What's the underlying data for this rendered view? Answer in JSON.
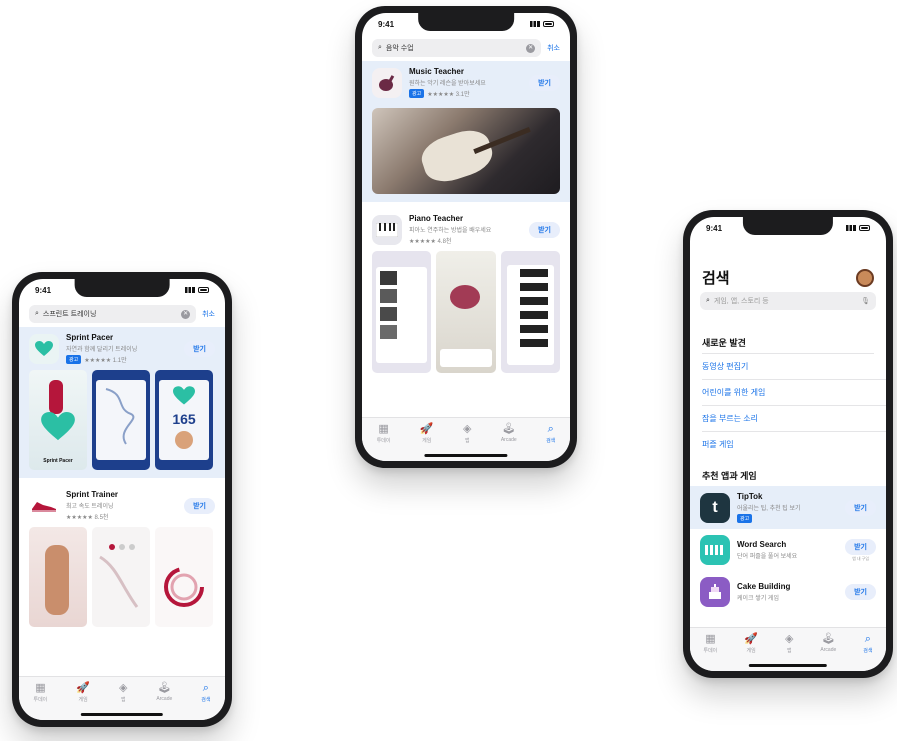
{
  "status": {
    "time": "9:41"
  },
  "tabs": [
    {
      "label": "투데이",
      "icon": "today-icon",
      "glyph": "▦"
    },
    {
      "label": "게임",
      "icon": "games-icon",
      "glyph": "🚀"
    },
    {
      "label": "앱",
      "icon": "apps-icon",
      "glyph": "◈"
    },
    {
      "label": "Arcade",
      "icon": "arcade-icon",
      "glyph": "🕹"
    },
    {
      "label": "검색",
      "icon": "search-tab-icon",
      "glyph": "⌕"
    }
  ],
  "phone_left": {
    "search": {
      "query": "스프린트 트레이닝",
      "cancel": "취소"
    },
    "apps": [
      {
        "name": "Sprint Pacer",
        "subtitle": "자연과 함께 달리기 트레이닝",
        "tag": "광고",
        "rating": "★★★★★ 1.1만",
        "button": "받기"
      },
      {
        "name": "Sprint Trainer",
        "subtitle": "최고 속도 트레이닝",
        "rating": "★★★★★ 8.5천",
        "button": "받기"
      }
    ],
    "shot_texts": {
      "pacer_label": "Sprint Pacer",
      "bpm": "165"
    }
  },
  "phone_center": {
    "search": {
      "query": "음악 수업",
      "cancel": "취소"
    },
    "apps": [
      {
        "name": "Music Teacher",
        "subtitle": "원하는 악기 레슨을 받아보세요",
        "tag": "광고",
        "rating": "★★★★★ 3.1만",
        "button": "받기"
      },
      {
        "name": "Piano Teacher",
        "subtitle": "피아노 연주하는 방법을 배우세요",
        "rating": "★★★★★ 4.8천",
        "button": "받기"
      }
    ]
  },
  "phone_right": {
    "title": "검색",
    "search_placeholder": "게임, 앱, 스토리 등",
    "discover_title": "새로운 발견",
    "discover_links": [
      "동영상 편집기",
      "어린이를 위한 게임",
      "잠을 부르는 소리",
      "퍼즐 게임"
    ],
    "recommended_title": "추천 앱과 게임",
    "apps": [
      {
        "name": "TipTok",
        "subtitle": "어울리는 팁, 추천 팁 보기",
        "tag": "광고",
        "button": "받기"
      },
      {
        "name": "Word Search",
        "subtitle": "단어 퍼즐을 풀어 보세요",
        "button": "받기",
        "note": "앱 내 구입"
      },
      {
        "name": "Cake Building",
        "subtitle": "케이크 쌓기 게임",
        "button": "받기"
      }
    ]
  },
  "colors": {
    "accent": "#1a73e8",
    "highlight": "#e6eef9",
    "frame": "#1c1c1e"
  }
}
